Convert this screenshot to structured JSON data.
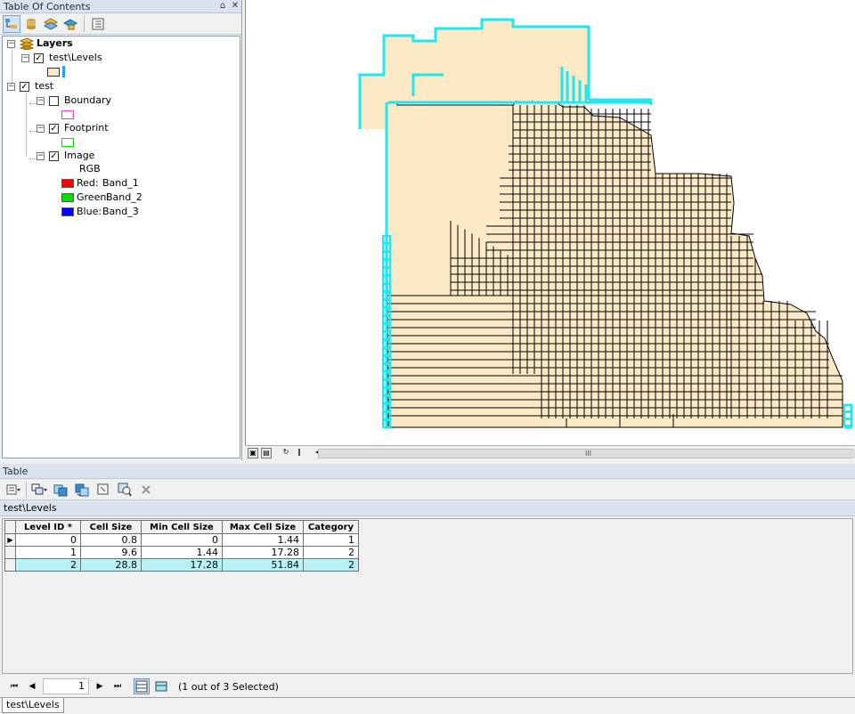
{
  "toc": {
    "title": "Table Of Contents",
    "pin_label": "⌂",
    "close_label": "✕",
    "tree": {
      "root": "Layers",
      "levels_layer": "test\\Levels",
      "group": "test",
      "boundary": "Boundary",
      "footprint": "Footprint",
      "image": "Image",
      "rgb_label": "RGB",
      "bands": [
        {
          "channel": "Red:",
          "band": "Band_1",
          "color": "#ff0000"
        },
        {
          "channel": "Green:",
          "band": "Band_2",
          "color": "#00e000"
        },
        {
          "channel": "Blue:",
          "band": "Band_3",
          "color": "#0000ff"
        }
      ]
    },
    "colors": {
      "levels_fill": "#fce9c6",
      "levels_stroke": "#2b9bff",
      "boundary": "#e040e0",
      "footprint": "#00e000"
    }
  },
  "map": {
    "fill_color": "#fce9c6",
    "selection_color": "#1ee8f0",
    "scroll_label": "III"
  },
  "table": {
    "title": "Table",
    "subtitle": "test\\Levels",
    "columns": [
      "Level ID *",
      "Cell Size",
      "Min Cell Size",
      "Max Cell Size",
      "Category"
    ],
    "rows": [
      {
        "level_id": "0",
        "cell_size": "0.8",
        "min": "0",
        "max": "1.44",
        "category": "1",
        "marker": "▶"
      },
      {
        "level_id": "1",
        "cell_size": "9.6",
        "min": "1.44",
        "max": "17.28",
        "category": "2",
        "marker": ""
      },
      {
        "level_id": "2",
        "cell_size": "28.8",
        "min": "17.28",
        "max": "51.84",
        "category": "2",
        "marker": ""
      }
    ],
    "nav": {
      "first": "⏮",
      "prev": "◀",
      "record": "1",
      "next": "▶",
      "last": "⏭",
      "status": "(1 out of 3 Selected)"
    },
    "tab": "test\\Levels"
  }
}
